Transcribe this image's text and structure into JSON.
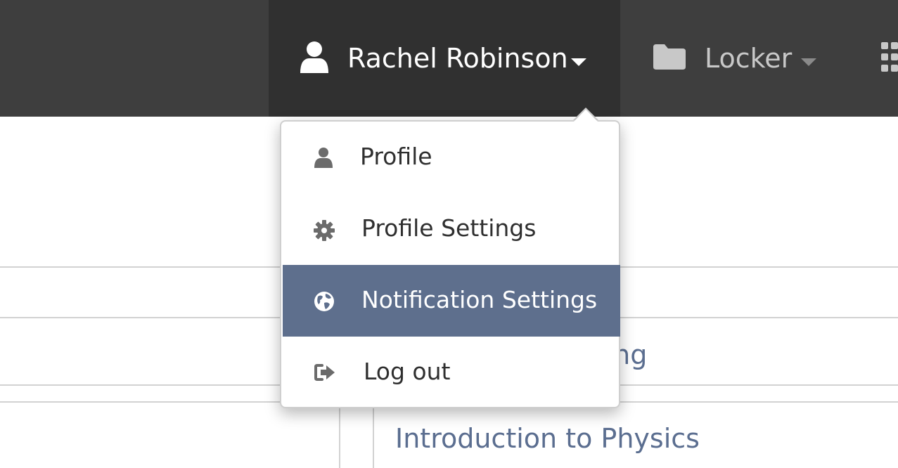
{
  "navbar": {
    "user_name": "Rachel Robinson",
    "user_icon": "user-icon",
    "locker_label": "Locker",
    "locker_icon": "folder-icon",
    "apps_icon": "grid-icon",
    "colors": {
      "bar": "#3e3e3e",
      "active_tab": "#303030"
    }
  },
  "dropdown": {
    "items": [
      {
        "label": "Profile",
        "icon": "user-icon"
      },
      {
        "label": "Profile Settings",
        "icon": "gear-icon"
      },
      {
        "label": "Notification Settings",
        "icon": "globe-icon",
        "highlighted": true
      },
      {
        "label": "Log out",
        "icon": "sign-out-icon"
      }
    ],
    "highlight_color": "#5e6f8d"
  },
  "main": {
    "courses": [
      {
        "label": "ring"
      },
      {
        "label": "Introduction to Physics"
      }
    ],
    "link_color": "#5b6e90"
  }
}
